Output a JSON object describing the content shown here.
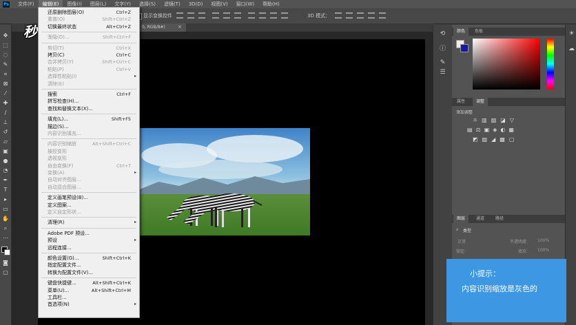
{
  "menubar": {
    "items": [
      "文件(F)",
      "编辑(E)",
      "图像(I)",
      "图层(L)",
      "文字(Y)",
      "选择(S)",
      "滤镜(T)",
      "3D(D)",
      "视图(V)",
      "窗口(W)",
      "帮助(H)"
    ],
    "active_index": 1
  },
  "optionsbar": {
    "transform_controls": "显示变换控件",
    "mode_3d": "3D 模式："
  },
  "document_tab": {
    "title": "0, RGB/8#)"
  },
  "watermark": {
    "text": "秒懂视频"
  },
  "edit_menu": {
    "items": [
      {
        "label": "还原删除图层(O)",
        "shortcut": "Ctrl+Z",
        "disabled": false
      },
      {
        "label": "重做(O)",
        "shortcut": "Shift+Ctrl+Z",
        "disabled": true
      },
      {
        "label": "切换最终状态",
        "shortcut": "Alt+Ctrl+Z",
        "disabled": false
      },
      {
        "sep": true
      },
      {
        "label": "渐隐(D)...",
        "shortcut": "Shift+Ctrl+F",
        "disabled": true
      },
      {
        "sep": true
      },
      {
        "label": "剪切(T)",
        "shortcut": "Ctrl+X",
        "disabled": true
      },
      {
        "label": "拷贝(C)",
        "shortcut": "Ctrl+C",
        "disabled": false
      },
      {
        "label": "合并拷贝(Y)",
        "shortcut": "Shift+Ctrl+C",
        "disabled": true
      },
      {
        "label": "粘贴(P)",
        "shortcut": "Ctrl+V",
        "disabled": true
      },
      {
        "label": "选择性粘贴(I)",
        "shortcut": "",
        "disabled": true,
        "submenu": true
      },
      {
        "label": "清除(E)",
        "shortcut": "",
        "disabled": true
      },
      {
        "sep": true
      },
      {
        "label": "搜索",
        "shortcut": "Ctrl+F",
        "disabled": false
      },
      {
        "label": "拼写检查(H)...",
        "shortcut": "",
        "disabled": false
      },
      {
        "label": "查找和替换文本(X)...",
        "shortcut": "",
        "disabled": false
      },
      {
        "sep": true
      },
      {
        "label": "填充(L)...",
        "shortcut": "Shift+F5",
        "disabled": false
      },
      {
        "label": "描边(S)...",
        "shortcut": "",
        "disabled": false
      },
      {
        "label": "内容识别填充...",
        "shortcut": "",
        "disabled": true
      },
      {
        "sep": true
      },
      {
        "label": "内容识别缩放",
        "shortcut": "Alt+Shift+Ctrl+C",
        "disabled": true
      },
      {
        "label": "操控变形",
        "shortcut": "",
        "disabled": true
      },
      {
        "label": "透视变形",
        "shortcut": "",
        "disabled": true
      },
      {
        "label": "自由变换(F)",
        "shortcut": "Ctrl+T",
        "disabled": true
      },
      {
        "label": "变换(A)",
        "shortcut": "",
        "disabled": true,
        "submenu": true
      },
      {
        "label": "自动对齐图层...",
        "shortcut": "",
        "disabled": true
      },
      {
        "label": "自动混合图层...",
        "shortcut": "",
        "disabled": true
      },
      {
        "sep": true
      },
      {
        "label": "定义画笔预设(B)...",
        "shortcut": "",
        "disabled": false
      },
      {
        "label": "定义图案...",
        "shortcut": "",
        "disabled": false
      },
      {
        "label": "定义自定形状...",
        "shortcut": "",
        "disabled": true
      },
      {
        "sep": true
      },
      {
        "label": "清理(R)",
        "shortcut": "",
        "disabled": false,
        "submenu": true
      },
      {
        "sep": true
      },
      {
        "label": "Adobe PDF 预设...",
        "shortcut": "",
        "disabled": false
      },
      {
        "label": "预设",
        "shortcut": "",
        "disabled": false,
        "submenu": true
      },
      {
        "label": "远程连接...",
        "shortcut": "",
        "disabled": false
      },
      {
        "sep": true
      },
      {
        "label": "颜色设置(G)...",
        "shortcut": "Shift+Ctrl+K",
        "disabled": false
      },
      {
        "label": "指定配置文件...",
        "shortcut": "",
        "disabled": false
      },
      {
        "label": "转换为配置文件(V)...",
        "shortcut": "",
        "disabled": false
      },
      {
        "sep": true
      },
      {
        "label": "键盘快捷键...",
        "shortcut": "Alt+Shift+Ctrl+K",
        "disabled": false
      },
      {
        "label": "菜单(U)...",
        "shortcut": "Alt+Shift+Ctrl+M",
        "disabled": false
      },
      {
        "label": "工具栏...",
        "shortcut": "",
        "disabled": false
      },
      {
        "label": "首选项(N)",
        "shortcut": "",
        "disabled": false,
        "submenu": true
      }
    ]
  },
  "color_panel": {
    "tabs": [
      "颜色",
      "色板"
    ]
  },
  "adjust_panel": {
    "tabs": [
      "属性",
      "调整"
    ],
    "heading": "添加调整"
  },
  "layers_panel": {
    "tabs": [
      "图层",
      "通道",
      "路径"
    ],
    "kind": "类型",
    "blend": "正常",
    "opacity_label": "不透明度:",
    "opacity": "100%",
    "lock_label": "锁定:",
    "fill_label": "填充:",
    "fill": "100%"
  },
  "tip": {
    "title": "小提示：",
    "body": "内容识别缩放是灰色的"
  },
  "colors": {
    "tip_bg": "#3d97e3",
    "menu_bg": "#f0f0f0",
    "canvas": "#000000"
  }
}
